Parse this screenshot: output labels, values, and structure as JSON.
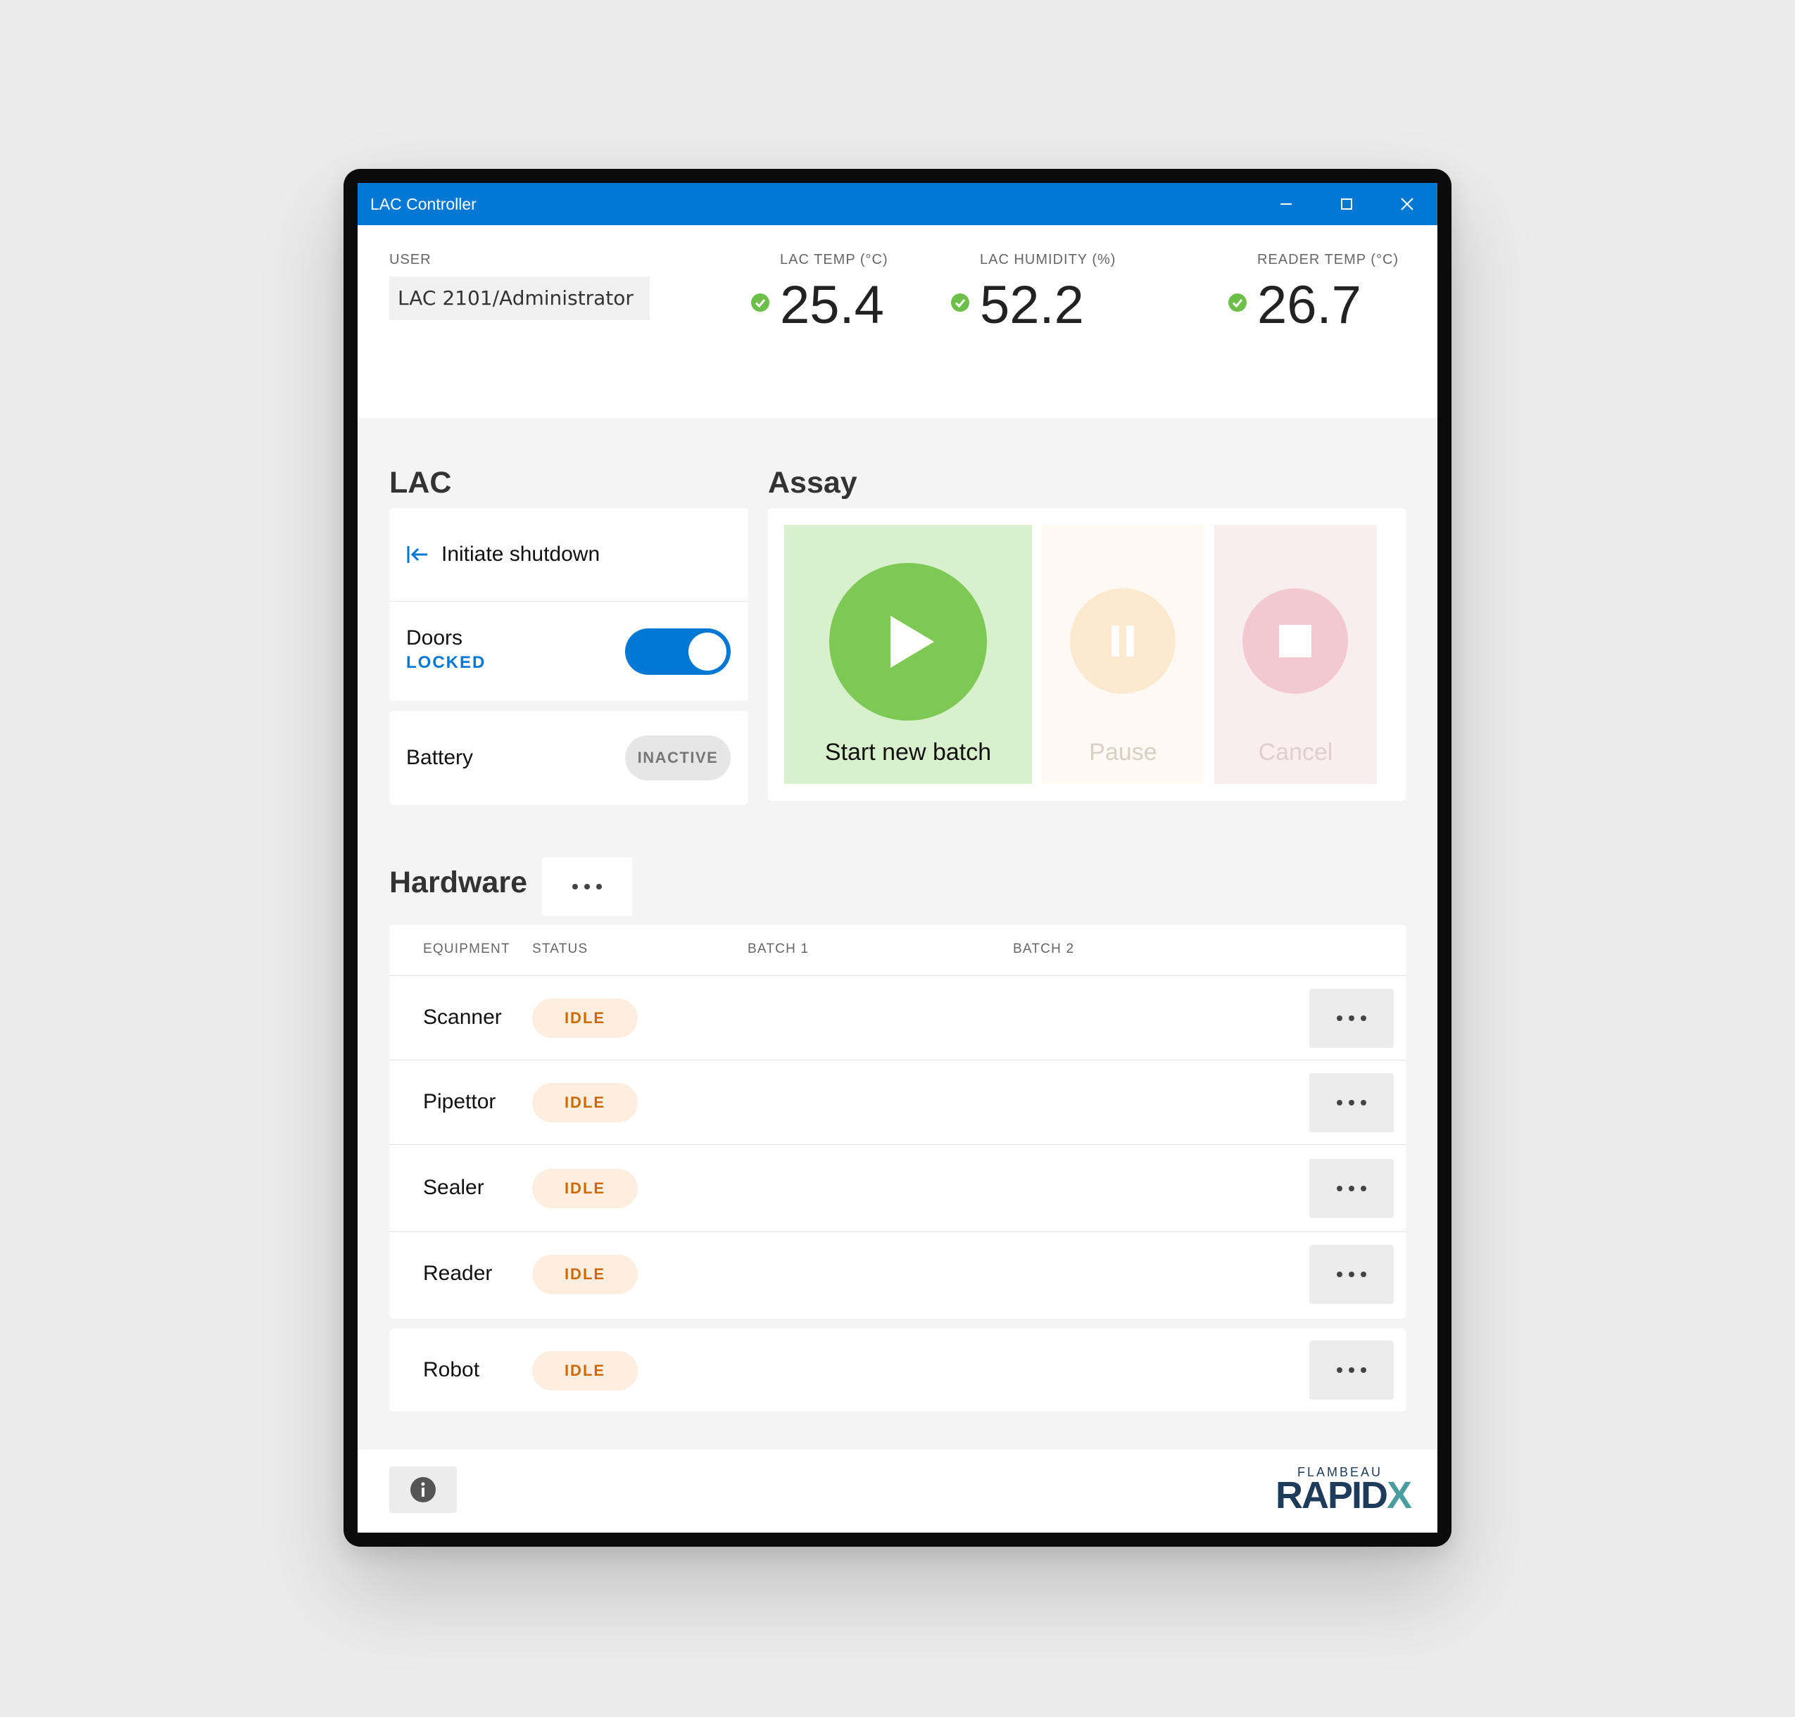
{
  "window": {
    "title": "LAC Controller",
    "minimize_icon": "minimize-icon",
    "maximize_icon": "maximize-icon",
    "close_icon": "close-icon",
    "accent": "#0078d4"
  },
  "header": {
    "user_label": "USER",
    "user_value": "LAC 2101/Administrator",
    "metrics": [
      {
        "label": "LAC TEMP (°C)",
        "value": "25.4",
        "status": "ok"
      },
      {
        "label": "LAC HUMIDITY (%)",
        "value": "52.2",
        "status": "ok"
      },
      {
        "label": "READER TEMP (°C)",
        "value": "26.7",
        "status": "ok"
      }
    ]
  },
  "lac": {
    "title": "LAC",
    "shutdown_label": "Initiate shutdown",
    "doors_label": "Doors",
    "doors_state": "LOCKED",
    "doors_toggle_on": true,
    "battery_label": "Battery",
    "battery_state": "INACTIVE"
  },
  "assay": {
    "title": "Assay",
    "start_label": "Start new batch",
    "pause_label": "Pause",
    "cancel_label": "Cancel",
    "start_color": "#7ec956",
    "pause_color": "#fde4c2",
    "cancel_color": "#f2c9cf"
  },
  "hardware": {
    "title": "Hardware",
    "columns": [
      "EQUIPMENT",
      "STATUS",
      "BATCH 1",
      "BATCH 2"
    ],
    "rows": [
      {
        "equipment": "Scanner",
        "status": "IDLE"
      },
      {
        "equipment": "Pipettor",
        "status": "IDLE"
      },
      {
        "equipment": "Sealer",
        "status": "IDLE"
      },
      {
        "equipment": "Reader",
        "status": "IDLE"
      },
      {
        "equipment": "Robot",
        "status": "IDLE"
      }
    ]
  },
  "footer": {
    "info_icon": "info-icon",
    "logo_small": "FLAMBEAU",
    "logo_big": "RAPID",
    "logo_accent": "X"
  }
}
